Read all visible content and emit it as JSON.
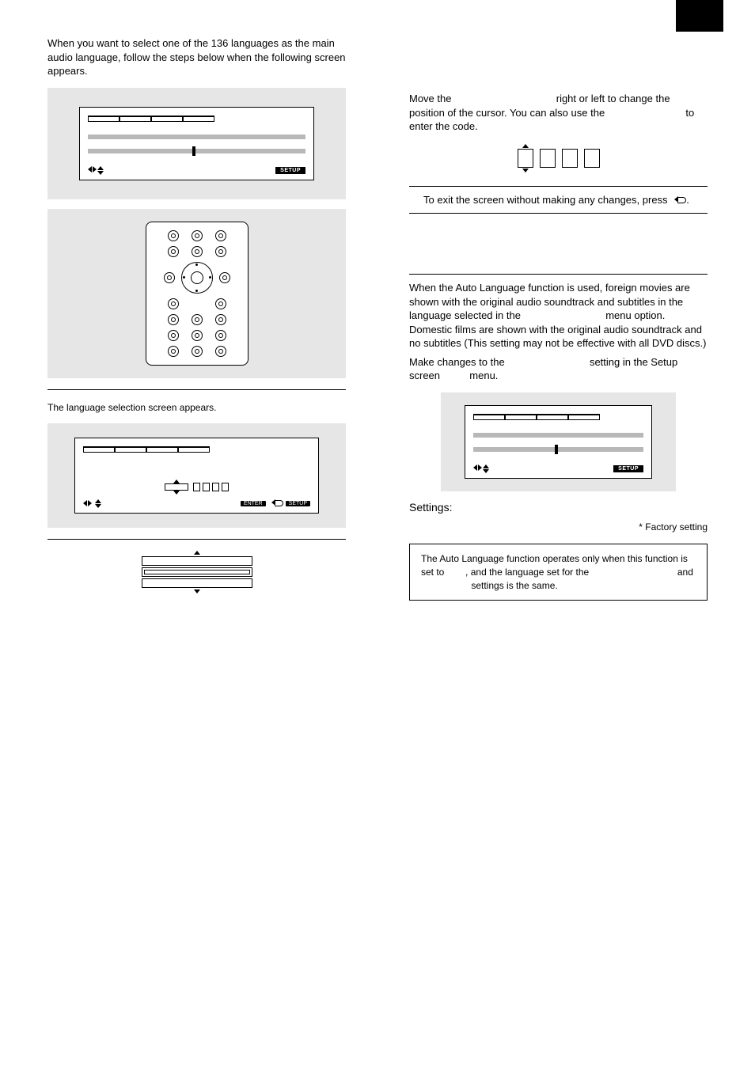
{
  "left": {
    "intro": "When you want to select one of the 136 languages as the main audio language, follow the steps below when the following screen appears.",
    "step_label": "The language selection screen appears.",
    "osd_badge": "SETUP",
    "key_enter": "ENTER",
    "key_setup": "SETUP"
  },
  "right": {
    "step_move_a": "Move the",
    "step_move_b": "right or left to change the position of the cursor. You can also use the",
    "step_move_c": "to enter the code.",
    "exit_text": "To exit the screen without making any changes, press",
    "auto_heading": "",
    "auto_para_a": "When the Auto Language function is used, foreign movies are shown with the original audio soundtrack and subtitles in the language selected in the",
    "auto_para_b": "menu option. Domestic films are shown with the original audio soundtrack and no subtitles (This setting may not be effective with all DVD discs.)",
    "make_changes_a": "Make changes to the",
    "make_changes_b": "setting in the Setup screen",
    "make_changes_c": "menu.",
    "settings_label": "Settings:",
    "factory": "* Factory setting",
    "note_a": "The Auto Language function operates only when this function is set to",
    "note_b": ", and the language set for the",
    "note_c": "and",
    "note_d": "settings is the same.",
    "osd_badge": "SETUP"
  }
}
